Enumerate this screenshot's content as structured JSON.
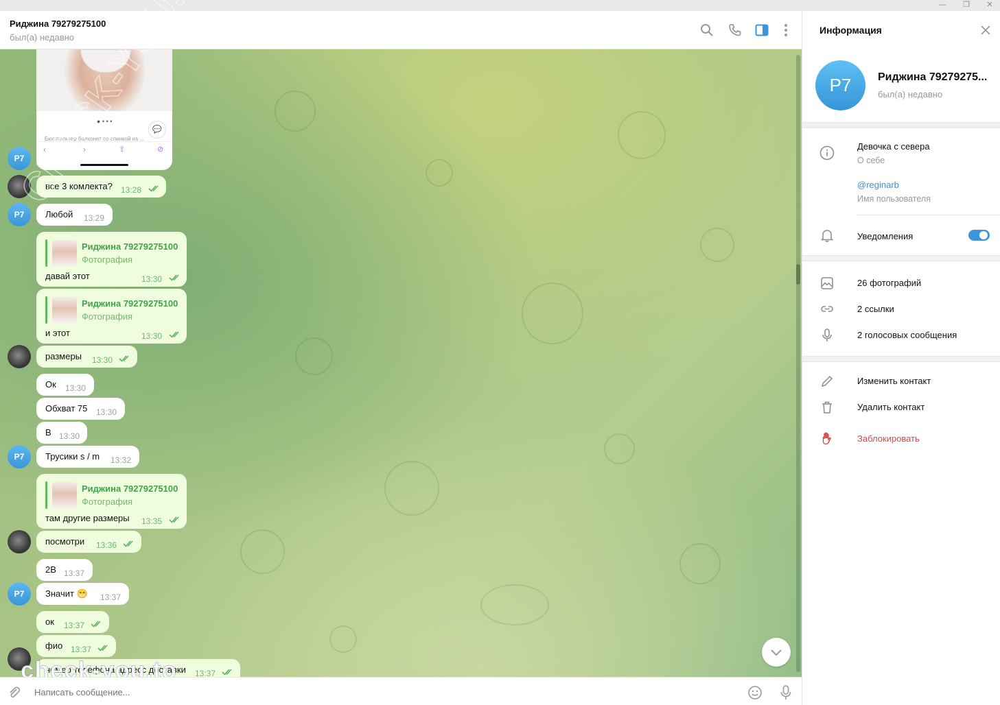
{
  "window": {
    "minimize": "—",
    "restore": "❐",
    "close": "✕"
  },
  "header": {
    "name": "Риджина 79279275100",
    "status": "был(а) недавно"
  },
  "messages": [
    {
      "kind": "out",
      "text": "все 3 комлекта?",
      "time": "13:28"
    },
    {
      "kind": "in",
      "text": "Любой",
      "time": "13:29"
    },
    {
      "kind": "in-reply",
      "reply_name": "Риджина 79279275100",
      "reply_sub": "Фотография",
      "text": "давай этот",
      "time": "13:30"
    },
    {
      "kind": "in-reply",
      "reply_name": "Риджина 79279275100",
      "reply_sub": "Фотография",
      "text": "и этот",
      "time": "13:30"
    },
    {
      "kind": "out",
      "text": "размеры",
      "time": "13:30"
    },
    {
      "kind": "in",
      "text": "Ок",
      "time": "13:30"
    },
    {
      "kind": "in",
      "text": "Обхват 75",
      "time": "13:30"
    },
    {
      "kind": "in",
      "text": "В",
      "time": "13:30"
    },
    {
      "kind": "in",
      "text": "Трусики s / m",
      "time": "13:32"
    },
    {
      "kind": "out-reply",
      "reply_name": "Риджина 79279275100",
      "reply_sub": "Фотография",
      "text": "там другие размеры",
      "time": "13:35"
    },
    {
      "kind": "out",
      "text": "посмотри",
      "time": "13:36"
    },
    {
      "kind": "in",
      "text": "2В",
      "time": "13:37"
    },
    {
      "kind": "in",
      "text": "Значит 😁",
      "time": "13:37"
    },
    {
      "kind": "out",
      "text": "ок",
      "time": "13:37"
    },
    {
      "kind": "out",
      "text": "фио",
      "time": "13:37"
    },
    {
      "kind": "out",
      "text": "номер телефона адресс доставки",
      "time": "13:37"
    }
  ],
  "avatars": {
    "initials": "Р7"
  },
  "photo_card": {
    "caption": "Бюстгальтер балконет со спинкой из ..."
  },
  "input": {
    "placeholder": "Написать сообщение..."
  },
  "panel": {
    "title": "Информация",
    "name": "Риджина 79279275...",
    "status": "был(а) недавно",
    "avatar": "Р7",
    "bio": "Девочка с севера",
    "bio_label": "О себе",
    "username": "@reginarb",
    "username_label": "Имя пользователя",
    "notifications": "Уведомления",
    "notifications_on": true,
    "photos": "26 фотографий",
    "links": "2 ссылки",
    "voice": "2 голосовых сообщения",
    "edit": "Изменить контакт",
    "delete": "Удалить контакт",
    "block": "Заблокировать"
  },
  "watermark": {
    "top": "CHECK-YOU.ME",
    "bottom": "check-you.to"
  },
  "colors": {
    "accent": "#3a96d6",
    "outgoing": "#effdde",
    "reply_green": "#3fa34a",
    "danger": "#d24949"
  }
}
